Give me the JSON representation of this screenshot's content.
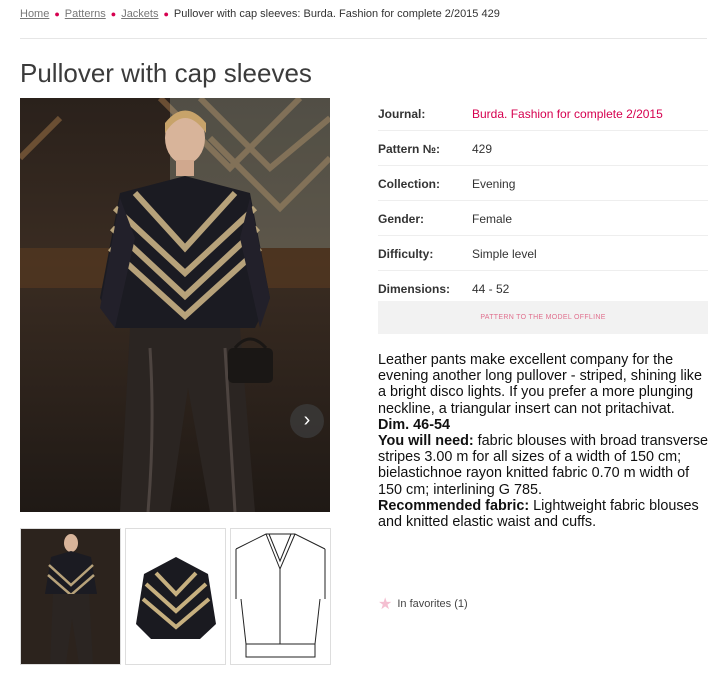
{
  "breadcrumb": {
    "home": "Home",
    "patterns": "Patterns",
    "jackets": "Jackets",
    "current": "Pullover with cap sleeves: Burda. Fashion for complete 2/2015 429"
  },
  "title": "Pullover with cap sleeves",
  "gallery": {
    "next_icon": "chevron-right-icon",
    "next_glyph": "›"
  },
  "details": [
    {
      "label": "Journal:",
      "value": "Burda. Fashion for complete 2/2015"
    },
    {
      "label": "Pattern №:",
      "value": "429"
    },
    {
      "label": "Collection:",
      "value": "Evening"
    },
    {
      "label": "Gender:",
      "value": "Female"
    },
    {
      "label": "Difficulty:",
      "value": "Simple level"
    },
    {
      "label": "Dimensions:",
      "value": "44 - 52"
    }
  ],
  "offline_button": "PATTERN TO THE MODEL OFFLINE",
  "description": {
    "intro": "Leather pants make excellent company for the evening another long pullover - striped, shining like a bright disco lights. If you prefer a more plunging neckline, a triangular insert can not pritachivat.",
    "dim": "Dim. 46-54",
    "need_label": "You will need:",
    "need_text": " fabric blouses with broad transverse stripes 3.00 m for all sizes of a width of 150 cm; bielastichnoe rayon knitted fabric 0.70 m width of 150 cm; interlining G 785.",
    "fabric_label": "Recommended fabric:",
    "fabric_text": " Lightweight fabric blouses and knitted elastic waist and cuffs."
  },
  "favorites": {
    "icon": "star-icon",
    "glyph": "★",
    "label": "In favorites (1)"
  },
  "colors": {
    "accent": "#d6004f",
    "button_bg": "#f2f2f2"
  }
}
